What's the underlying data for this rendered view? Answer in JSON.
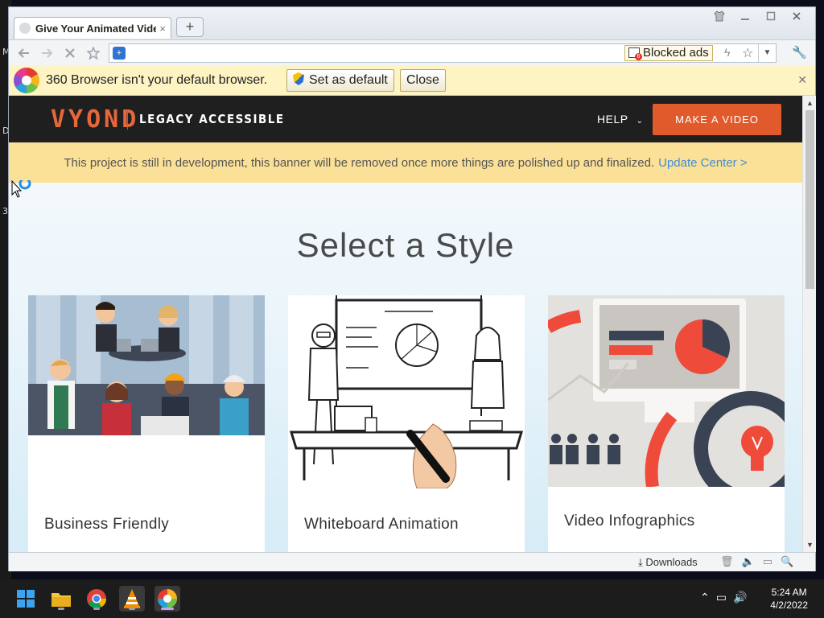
{
  "desktop": {
    "edge_letters": [
      "M",
      "D",
      "3"
    ]
  },
  "browser": {
    "tab": {
      "title": "Give Your Animated Vide",
      "close": "×"
    },
    "new_tab": "+",
    "window_controls": [
      "shirt-icon",
      "minimize-icon",
      "maximize-icon",
      "close-icon"
    ],
    "address": {
      "url": "",
      "blocked_ads_label": "Blocked ads",
      "blocked_count": "6"
    },
    "infobar": {
      "message": "360 Browser isn't your default browser.",
      "set_default_label": "Set as default",
      "close_label": "Close"
    },
    "statusbar": {
      "downloads_label": "Downloads"
    }
  },
  "site": {
    "brand": "VYOND",
    "brand_tagline": "LEGACY ACCESSIBLE",
    "nav": {
      "help_label": "HELP",
      "cta_label": "MAKE A VIDEO"
    },
    "banner": {
      "text": "This project is still in development, this banner will be removed once more things are polished up and finalized.",
      "link_text": "Update Center >"
    },
    "page_title": "Select a Style",
    "styles": [
      {
        "label": "Business Friendly"
      },
      {
        "label": "Whiteboard Animation"
      },
      {
        "label": "Video Infographics"
      }
    ]
  },
  "taskbar": {
    "apps": [
      "windows-start-icon",
      "file-explorer-icon",
      "chrome-icon",
      "vlc-icon",
      "360-browser-icon"
    ],
    "clock": {
      "time": "5:24 AM",
      "date": "4/2/2022"
    }
  },
  "colors": {
    "accent": "#e15a2b",
    "banner_bg": "#fbe097",
    "link": "#3f8fd8",
    "nav_bg": "#1f1f1f"
  }
}
